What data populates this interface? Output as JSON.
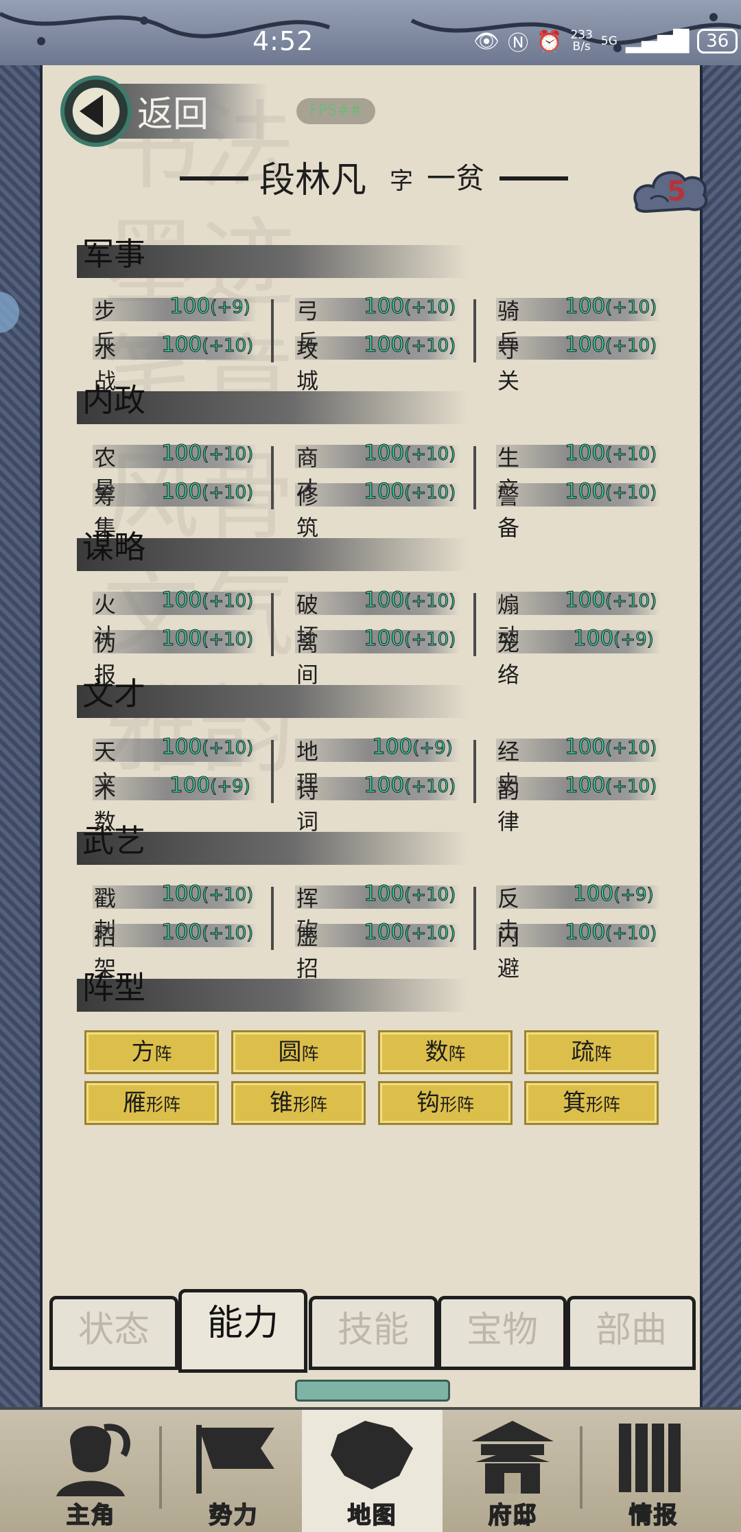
{
  "status_bar": {
    "time": "4:52",
    "speed_value": "233",
    "speed_unit": "B/s",
    "network": "5G",
    "battery": "36"
  },
  "header": {
    "back_label": "返回",
    "fps": "FPS##"
  },
  "character": {
    "name": "段林凡",
    "zi_label": "字",
    "style_name": "一贫",
    "level_badge": "5"
  },
  "sections": [
    {
      "title": "军事",
      "stats": [
        {
          "name": "步兵",
          "value": "100",
          "bonus": "(+9)"
        },
        {
          "name": "弓兵",
          "value": "100",
          "bonus": "(+10)"
        },
        {
          "name": "骑兵",
          "value": "100",
          "bonus": "(+10)"
        },
        {
          "name": "水战",
          "value": "100",
          "bonus": "(+10)"
        },
        {
          "name": "攻城",
          "value": "100",
          "bonus": "(+10)"
        },
        {
          "name": "守关",
          "value": "100",
          "bonus": "(+10)"
        }
      ]
    },
    {
      "title": "内政",
      "stats": [
        {
          "name": "农垦",
          "value": "100",
          "bonus": "(+10)"
        },
        {
          "name": "商才",
          "value": "100",
          "bonus": "(+10)"
        },
        {
          "name": "生产",
          "value": "100",
          "bonus": "(+10)"
        },
        {
          "name": "筹集",
          "value": "100",
          "bonus": "(+10)"
        },
        {
          "name": "修筑",
          "value": "100",
          "bonus": "(+10)"
        },
        {
          "name": "警备",
          "value": "100",
          "bonus": "(+10)"
        }
      ]
    },
    {
      "title": "谋略",
      "stats": [
        {
          "name": "火计",
          "value": "100",
          "bonus": "(+10)"
        },
        {
          "name": "破坏",
          "value": "100",
          "bonus": "(+10)"
        },
        {
          "name": "煽动",
          "value": "100",
          "bonus": "(+10)"
        },
        {
          "name": "伪报",
          "value": "100",
          "bonus": "(+10)"
        },
        {
          "name": "离间",
          "value": "100",
          "bonus": "(+10)"
        },
        {
          "name": "笼络",
          "value": "100",
          "bonus": "(+9)"
        }
      ]
    },
    {
      "title": "文才",
      "stats": [
        {
          "name": "天文",
          "value": "100",
          "bonus": "(+10)"
        },
        {
          "name": "地理",
          "value": "100",
          "bonus": "(+9)"
        },
        {
          "name": "经史",
          "value": "100",
          "bonus": "(+10)"
        },
        {
          "name": "术数",
          "value": "100",
          "bonus": "(+9)"
        },
        {
          "name": "诗词",
          "value": "100",
          "bonus": "(+10)"
        },
        {
          "name": "韵律",
          "value": "100",
          "bonus": "(+10)"
        }
      ]
    },
    {
      "title": "武艺",
      "stats": [
        {
          "name": "戳刺",
          "value": "100",
          "bonus": "(+10)"
        },
        {
          "name": "挥砍",
          "value": "100",
          "bonus": "(+10)"
        },
        {
          "name": "反击",
          "value": "100",
          "bonus": "(+9)"
        },
        {
          "name": "招架",
          "value": "100",
          "bonus": "(+10)"
        },
        {
          "name": "虚招",
          "value": "100",
          "bonus": "(+10)"
        },
        {
          "name": "闪避",
          "value": "100",
          "bonus": "(+10)"
        }
      ]
    }
  ],
  "formation_title": "阵型",
  "formations": [
    {
      "main": "方",
      "suffix": "阵"
    },
    {
      "main": "圆",
      "suffix": "阵"
    },
    {
      "main": "数",
      "suffix": "阵"
    },
    {
      "main": "疏",
      "suffix": "阵"
    },
    {
      "main": "雁",
      "suffix": "形阵"
    },
    {
      "main": "锥",
      "suffix": "形阵"
    },
    {
      "main": "钩",
      "suffix": "形阵"
    },
    {
      "main": "箕",
      "suffix": "形阵"
    }
  ],
  "tabs": [
    "状态",
    "能力",
    "技能",
    "宝物",
    "部曲"
  ],
  "active_tab": "能力",
  "bottom_nav": [
    {
      "label": "主角",
      "icon": "hero-portrait-icon"
    },
    {
      "label": "势力",
      "icon": "flag-icon"
    },
    {
      "label": "地图",
      "icon": "map-icon"
    },
    {
      "label": "府邸",
      "icon": "mansion-icon"
    },
    {
      "label": "情报",
      "icon": "scroll-bamboo-icon"
    }
  ],
  "colors": {
    "stat_value": "#3cd6a0",
    "formation_button": "#dcbf4b",
    "level_badge_text": "#b8323a",
    "frame": "#3e4a64"
  }
}
